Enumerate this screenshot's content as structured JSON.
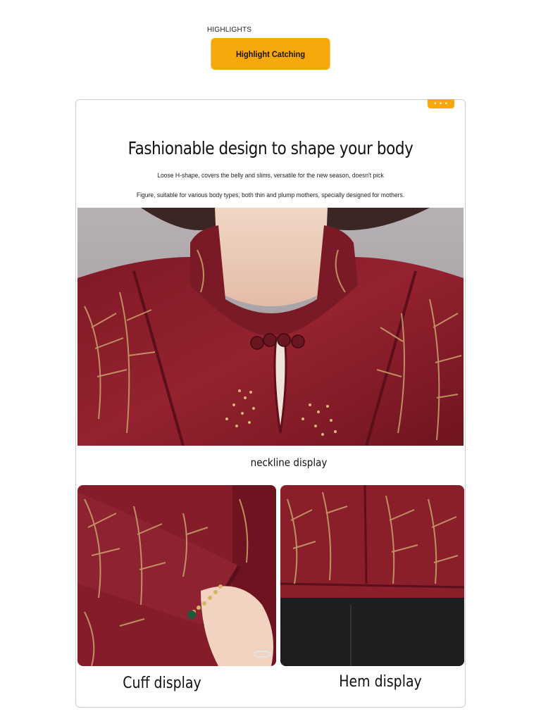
{
  "header": {
    "eyebrow": "HIGHLIGHTS",
    "pill_label": "Highlight Catching",
    "accent_color": "#f7a90c"
  },
  "card": {
    "corner_tab": "• • •",
    "headline": "Fashionable design to shape your body",
    "sub_line_1": "Loose H-shape, covers the belly and slims, versatile for the new season, doesn't pick",
    "sub_line_2": "Figure, suitable for various body types, both thin and plump mothers, specially designed for mothers."
  },
  "photos": {
    "main_caption": "neckline display",
    "cuff_caption": "Cuff display",
    "hem_caption": "Hem display",
    "garment_color": "#8e1f2b",
    "pattern_color": "#c9a46a"
  }
}
